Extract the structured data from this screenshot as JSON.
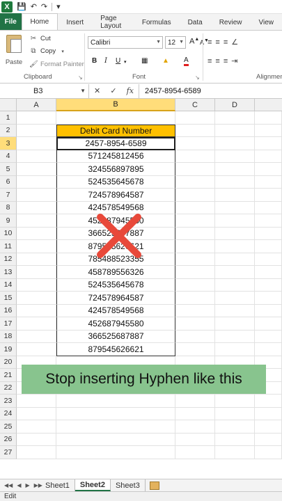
{
  "app": {
    "logo": "X"
  },
  "quick_access": {
    "save_icon": "save-icon",
    "undo_icon": "undo-icon",
    "redo_icon": "redo-icon",
    "customize_icon": "chevron-down-icon"
  },
  "ribbon_tabs": [
    {
      "label": "File"
    },
    {
      "label": "Home"
    },
    {
      "label": "Insert"
    },
    {
      "label": "Page Layout"
    },
    {
      "label": "Formulas"
    },
    {
      "label": "Data"
    },
    {
      "label": "Review"
    },
    {
      "label": "View"
    }
  ],
  "clipboard": {
    "paste": "Paste",
    "cut": "Cut",
    "copy": "Copy",
    "format_painter": "Format Painter",
    "group_label": "Clipboard"
  },
  "font": {
    "name": "Calibri",
    "size": "12",
    "group_label": "Font",
    "bold": "B",
    "italic": "I",
    "underline": "U"
  },
  "alignment": {
    "group_label": "Alignmen"
  },
  "formula_bar": {
    "name_box": "B3",
    "value": "2457-8954-6589"
  },
  "columns": [
    "A",
    "B",
    "C",
    "D"
  ],
  "rows": [
    "1",
    "2",
    "3",
    "4",
    "5",
    "6",
    "7",
    "8",
    "9",
    "10",
    "11",
    "12",
    "13",
    "14",
    "15",
    "16",
    "17",
    "18",
    "19",
    "20",
    "21",
    "22",
    "23",
    "24",
    "25",
    "26",
    "27"
  ],
  "table": {
    "header": "Debit Card Number",
    "values": [
      "2457-8954-6589",
      "571245812456",
      "324556897895",
      "524535645678",
      "724578964587",
      "424578549568",
      "452687945580",
      "366525687887",
      "879545626621",
      "785488523355",
      "458789556326",
      "524535645678",
      "724578964587",
      "424578549568",
      "452687945580",
      "366525687887",
      "879545626621"
    ]
  },
  "banner": {
    "text": "Stop inserting Hyphen like this"
  },
  "sheets": [
    {
      "label": "Sheet1"
    },
    {
      "label": "Sheet2",
      "active": true
    },
    {
      "label": "Sheet3"
    }
  ],
  "status": {
    "mode": "Edit"
  },
  "colors": {
    "header_fill": "#ffc000",
    "banner_fill": "#88c48e",
    "excel_green": "#217346",
    "cross_red": "#e8493a"
  }
}
